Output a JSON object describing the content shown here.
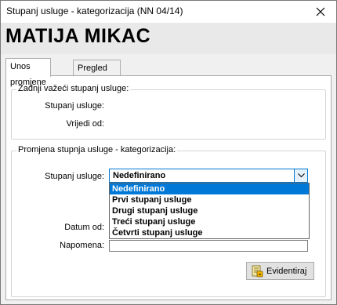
{
  "window": {
    "title": "Stupanj usluge - kategorizacija (NN 04/14)"
  },
  "banner": {
    "name": "MATIJA MIKAC"
  },
  "tabs": [
    {
      "label": "Unos promjene",
      "active": true
    },
    {
      "label": "Pregled evidencije",
      "active": false
    }
  ],
  "current_group": {
    "title": "Zadnji važeći stupanj usluge:",
    "level_label": "Stupanj usluge:",
    "valid_from_label": "Vrijedi od:"
  },
  "change_group": {
    "title": "Promjena stupnja usluge - kategorizacija:",
    "level_label": "Stupanj usluge:",
    "level_value": "Nedefinirano",
    "level_options": [
      "Nedefinirano",
      "Prvi stupanj usluge",
      "Drugi stupanj usluge",
      "Treći stupanj usluge",
      "Četvrti stupanj usluge"
    ],
    "date_label": "Datum od:",
    "note_label": "Napomena:",
    "note_value": "",
    "submit_label": "Evidentiraj"
  },
  "colors": {
    "accent": "#0078d7",
    "selection_text": "#ffffff"
  },
  "icons": {
    "close": "close-icon",
    "dropdown": "chevron-down-icon",
    "submit": "register-icon"
  }
}
